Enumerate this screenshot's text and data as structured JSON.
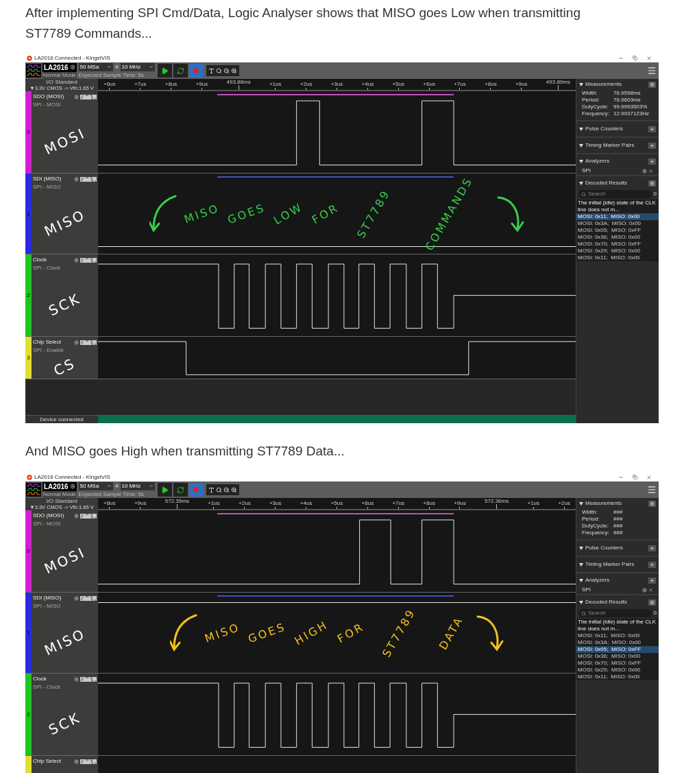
{
  "shots": [
    {
      "intro": "After implementing SPI Cmd/Data, Logic Analyser shows that MISO goes Low when transmitting ST7789 Commands...",
      "window_title": "LA2016 Connected - KingstVIS",
      "toolbar": {
        "device": "LA2016",
        "mode": "Normal Mode",
        "sample_rate": "50 MSa",
        "frequency": "10 MHz",
        "expected_time": "Expected Sample Time: 5s"
      },
      "io_standard": {
        "title": "I/O Standard",
        "value": "▼3.3V CMOS -> Vth:1.65 V"
      },
      "ruler": [
        {
          "label": "+6us",
          "kind": "minor"
        },
        {
          "label": "+7us",
          "kind": "minor"
        },
        {
          "label": "+8us",
          "kind": "minor"
        },
        {
          "label": "+9us",
          "kind": "minor"
        },
        {
          "label": "493.88ms",
          "kind": "major"
        },
        {
          "label": "+1us",
          "kind": "minor"
        },
        {
          "label": "+2us",
          "kind": "minor"
        },
        {
          "label": "+3us",
          "kind": "minor"
        },
        {
          "label": "+4us",
          "kind": "minor"
        },
        {
          "label": "+5us",
          "kind": "minor"
        },
        {
          "label": "+6us",
          "kind": "minor"
        },
        {
          "label": "+7us",
          "kind": "minor"
        },
        {
          "label": "+8us",
          "kind": "minor"
        },
        {
          "label": "+9us",
          "kind": "minor"
        },
        {
          "label": "493.89ms",
          "kind": "major"
        }
      ],
      "channels": [
        {
          "name": "SDO (MOSI)",
          "subtitle": "SPI - MOSI",
          "number": "0",
          "color": "#d21fd2",
          "note": "MOSI"
        },
        {
          "name": "SDI (MISO)",
          "subtitle": "SPI - MISO",
          "number": "1",
          "color": "#2a2ae0",
          "note": "MISO"
        },
        {
          "name": "Clock",
          "subtitle": "SPI - Clock",
          "number": "2",
          "color": "#1fc41f",
          "note": "SCK"
        },
        {
          "name": "Chip Select",
          "subtitle": "SPI - Enable",
          "number": "3",
          "color": "#e0e030",
          "note": "CS"
        }
      ],
      "annotation": {
        "color": "#35d04a",
        "words": [
          "MISO",
          "GOES",
          "LOW",
          "FOR",
          "ST7789",
          "COMMANDS"
        ]
      },
      "status": "Device connected",
      "panel": {
        "measurements": {
          "title": "Measurements",
          "rows": [
            {
              "label": "Width:",
              "value": "76.9598ms"
            },
            {
              "label": "Period:",
              "value": "76.9603ms"
            },
            {
              "label": "DutyCycle:",
              "value": "99.9993503%"
            },
            {
              "label": "Frequency:",
              "value": "12.9937123Hz"
            }
          ]
        },
        "sections": [
          "Pulse Counters",
          "Timing Marker Pairs"
        ],
        "analyzers": {
          "title": "Analyzers",
          "items": [
            "SPI"
          ]
        },
        "decoded": {
          "title": "Decoded Results",
          "placeholder": "Search",
          "count": "0",
          "note": "The initial (idle) state of the CLK line does not m...",
          "rows": [
            {
              "text": "MOSI: 0x11;  MISO: 0x00",
              "selected": true
            },
            {
              "text": "MOSI: 0x3A;  MISO: 0x00",
              "selected": false
            },
            {
              "text": "MOSI: 0x05;  MISO: 0xFF",
              "selected": false
            },
            {
              "text": "MOSI: 0x36;  MISO: 0x00",
              "selected": false
            },
            {
              "text": "MOSI: 0x70;  MISO: 0xFF",
              "selected": false
            },
            {
              "text": "MOSI: 0x29;  MISO: 0x00",
              "selected": false
            },
            {
              "text": "MOSI: 0x11;  MISO: 0x00",
              "selected": false
            }
          ]
        }
      }
    },
    {
      "intro": "And MISO goes High when transmitting ST7789 Data...",
      "window_title": "LA2016 Connected - KingstVIS",
      "toolbar": {
        "device": "LA2016",
        "mode": "Normal Mode",
        "sample_rate": "50 MSa",
        "frequency": "10 MHz",
        "expected_time": "Expected Sample Time: 5s"
      },
      "io_standard": {
        "title": "I/O Standard",
        "value": "▼3.3V CMOS -> Vth:1.65 V"
      },
      "ruler": [
        {
          "label": "+8us",
          "kind": "minor"
        },
        {
          "label": "+9us",
          "kind": "minor"
        },
        {
          "label": "572.35ms",
          "kind": "major"
        },
        {
          "label": "+1us",
          "kind": "minor"
        },
        {
          "label": "+2us",
          "kind": "minor"
        },
        {
          "label": "+3us",
          "kind": "minor"
        },
        {
          "label": "+4us",
          "kind": "minor"
        },
        {
          "label": "+5us",
          "kind": "minor"
        },
        {
          "label": "+6us",
          "kind": "minor"
        },
        {
          "label": "+7us",
          "kind": "minor"
        },
        {
          "label": "+8us",
          "kind": "minor"
        },
        {
          "label": "+9us",
          "kind": "minor"
        },
        {
          "label": "572.36ms",
          "kind": "major"
        },
        {
          "label": "+1us",
          "kind": "minor"
        },
        {
          "label": "+2us",
          "kind": "minor"
        }
      ],
      "channels": [
        {
          "name": "SDO (MOSI)",
          "subtitle": "SPI - MOSI",
          "number": "0",
          "color": "#d21fd2",
          "note": "MOSI"
        },
        {
          "name": "SDI (MISO)",
          "subtitle": "SPI - MISO",
          "number": "1",
          "color": "#2a2ae0",
          "note": "MISO"
        },
        {
          "name": "Clock",
          "subtitle": "SPI - Clock",
          "number": "2",
          "color": "#1fc41f",
          "note": "SCK"
        },
        {
          "name": "Chip Select",
          "color": "#e0e030"
        }
      ],
      "annotation": {
        "color": "#f2c21a",
        "words": [
          "MISO",
          "GOES",
          "HIGH",
          "FOR",
          "ST7789",
          "DATA"
        ]
      },
      "panel": {
        "measurements": {
          "title": "Measurements",
          "rows": [
            {
              "label": "Width:",
              "value": "###"
            },
            {
              "label": "Period:",
              "value": "###"
            },
            {
              "label": "DutyCycle:",
              "value": "###"
            },
            {
              "label": "Frequency:",
              "value": "###"
            }
          ]
        },
        "sections": [
          "Pulse Counters",
          "Timing Marker Pairs"
        ],
        "analyzers": {
          "title": "Analyzers",
          "items": [
            "SPI"
          ]
        },
        "decoded": {
          "title": "Decoded Results",
          "placeholder": "Search",
          "count": "0",
          "note": "The initial (idle) state of the CLK line does not m...",
          "rows": [
            {
              "text": "MOSI: 0x11;  MISO: 0x00",
              "selected": false
            },
            {
              "text": "MOSI: 0x3A;  MISO: 0x00",
              "selected": false
            },
            {
              "text": "MOSI: 0x05;  MISO: 0xFF",
              "selected": true
            },
            {
              "text": "MOSI: 0x36;  MISO: 0x00",
              "selected": false
            },
            {
              "text": "MOSI: 0x70;  MISO: 0xFF",
              "selected": false
            },
            {
              "text": "MOSI: 0x29;  MISO: 0x00",
              "selected": false
            },
            {
              "text": "MOSI: 0x11;  MISO: 0x00",
              "selected": false
            }
          ]
        }
      }
    }
  ]
}
